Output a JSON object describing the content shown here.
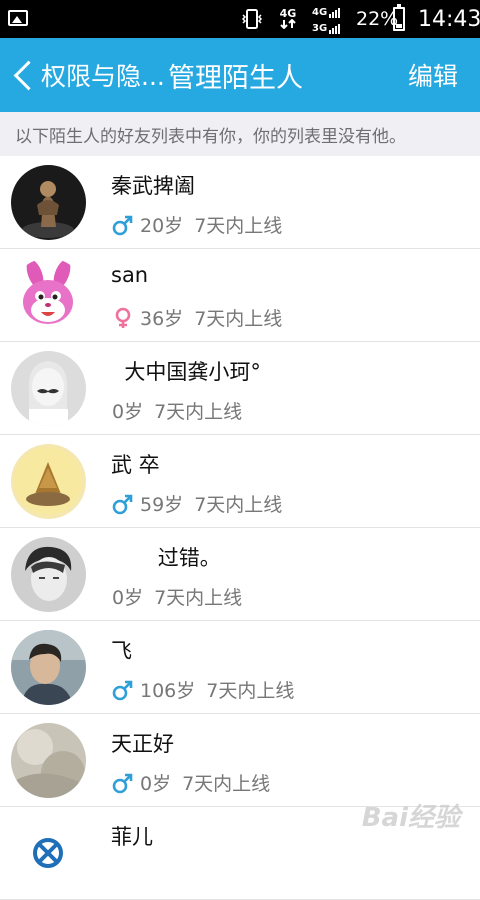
{
  "status_bar": {
    "network_4g": "4G",
    "network_4g_small": "4G",
    "network_3g_small": "3G",
    "battery_percent": "22%",
    "time": "14:43"
  },
  "app_bar": {
    "back_label": "权限与隐...",
    "title": "管理陌生人",
    "edit_label": "编辑"
  },
  "notice": "以下陌生人的好友列表中有你，你的列表里没有他。",
  "colors": {
    "accent": "#26a9e1",
    "male": "#2f9fd8",
    "female": "#f0719a"
  },
  "people": [
    {
      "name": "秦武捭阖",
      "gender": "male",
      "age": "20岁",
      "online": "7天内上线"
    },
    {
      "name": "san",
      "gender": "female",
      "age": "36岁",
      "online": "7天内上线"
    },
    {
      "name": "  大中国龚小珂°",
      "gender": "none",
      "age": "0岁",
      "online": "7天内上线"
    },
    {
      "name": "武 卒",
      "gender": "male",
      "age": "59岁",
      "online": "7天内上线"
    },
    {
      "name": "       过错。",
      "gender": "none",
      "age": "0岁",
      "online": "7天内上线"
    },
    {
      "name": "飞",
      "gender": "male",
      "age": "106岁",
      "online": "7天内上线"
    },
    {
      "name": "天正好",
      "gender": "male",
      "age": "0岁",
      "online": "7天内上线"
    },
    {
      "name": "菲儿",
      "gender": "none",
      "age": "",
      "online": ""
    }
  ],
  "watermark": "Bai经验"
}
